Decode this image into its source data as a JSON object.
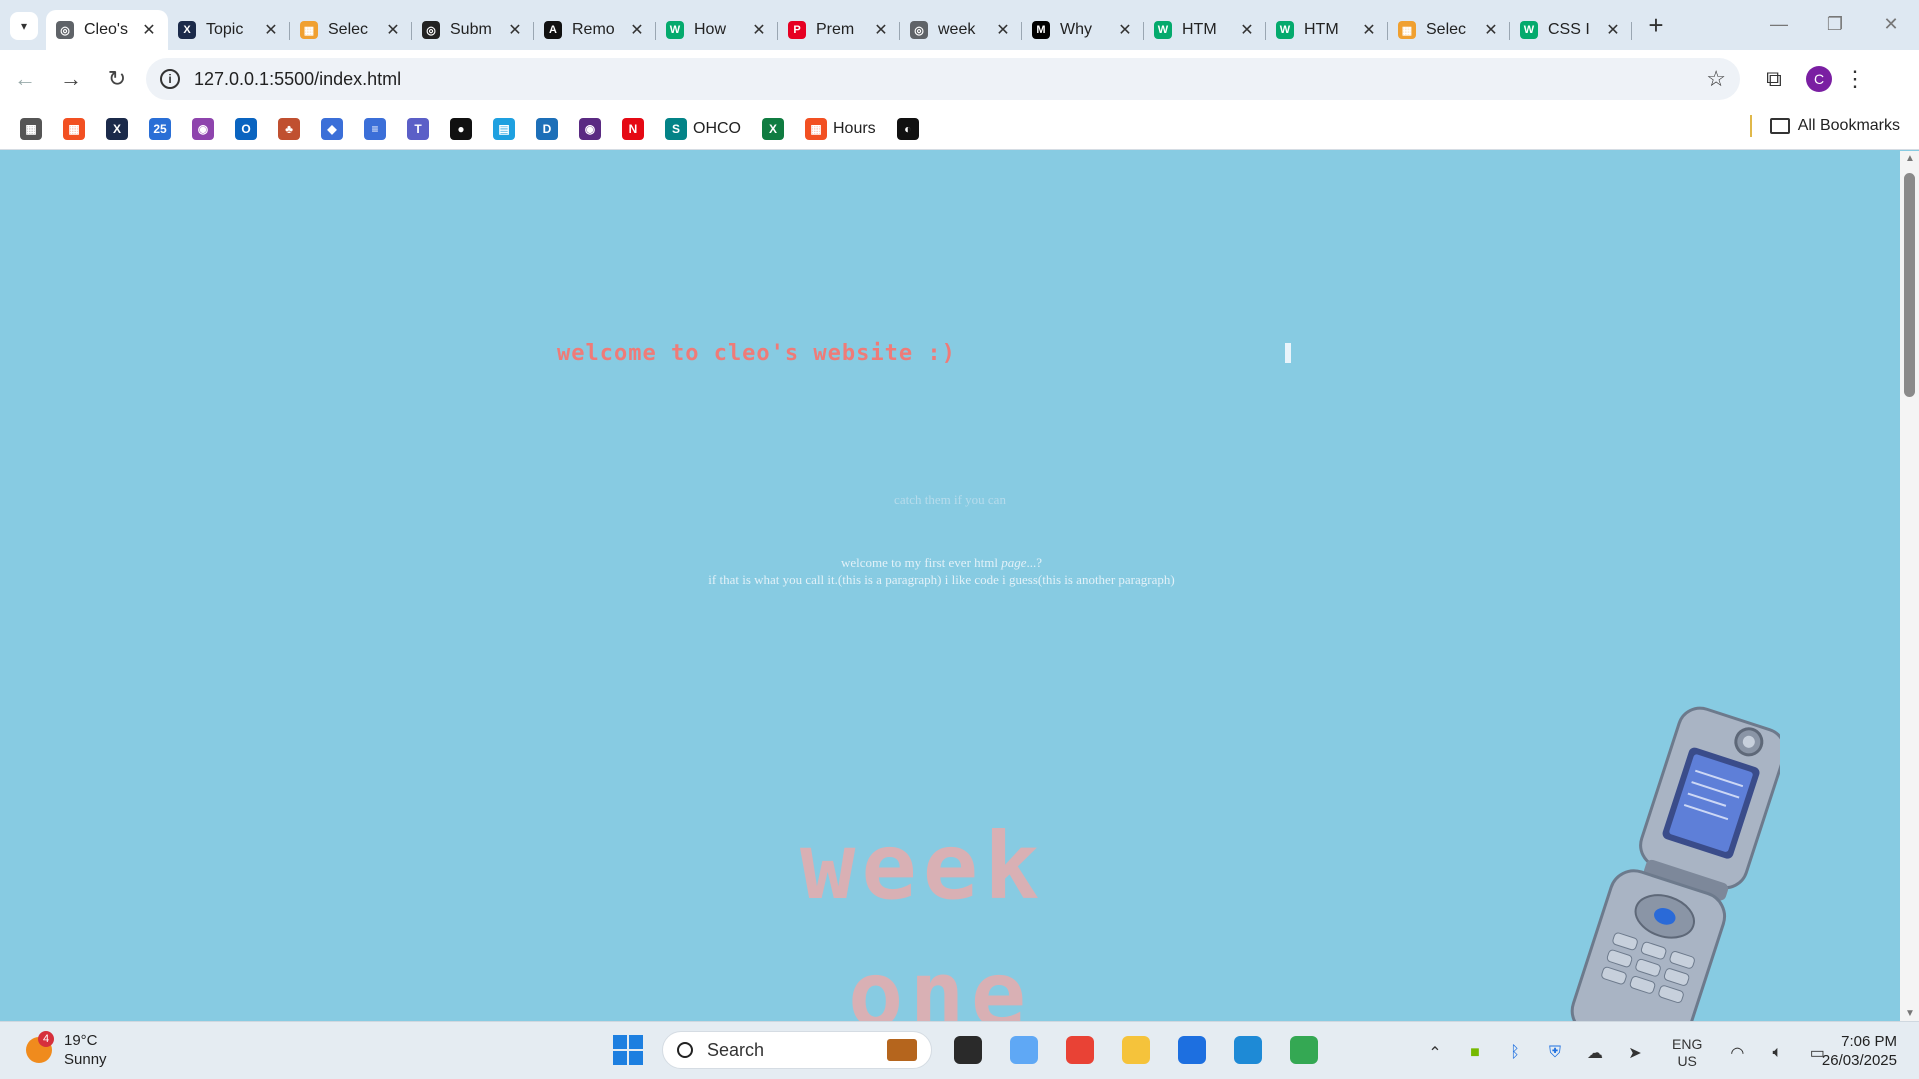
{
  "browser": {
    "tabs": [
      {
        "label": "Cleo's",
        "color": "#5f6368",
        "glyph": "◎",
        "active": true
      },
      {
        "label": "Topic",
        "color": "#1b2a4a",
        "glyph": "X"
      },
      {
        "label": "Selec",
        "color": "#f0a030",
        "glyph": "▦"
      },
      {
        "label": "Subm",
        "color": "#222222",
        "glyph": "◎"
      },
      {
        "label": "Remo",
        "color": "#111111",
        "glyph": "A"
      },
      {
        "label": "How",
        "color": "#04aa6d",
        "glyph": "W"
      },
      {
        "label": "Prem",
        "color": "#e60023",
        "glyph": "P"
      },
      {
        "label": "week",
        "color": "#5f6368",
        "glyph": "◎"
      },
      {
        "label": "Why",
        "color": "#000000",
        "glyph": "M"
      },
      {
        "label": "HTM",
        "color": "#04aa6d",
        "glyph": "W"
      },
      {
        "label": "HTM",
        "color": "#04aa6d",
        "glyph": "W"
      },
      {
        "label": "Selec",
        "color": "#f0a030",
        "glyph": "▦"
      },
      {
        "label": "CSS I",
        "color": "#04aa6d",
        "glyph": "W"
      }
    ],
    "tab_close": "✕",
    "new_tab": "+",
    "window": {
      "minimize": "—",
      "restore": "❐",
      "close": "✕"
    },
    "nav": {
      "back": "←",
      "forward": "→",
      "reload": "↻"
    },
    "url": "127.0.0.1:5500/index.html",
    "info_icon": "i",
    "star": "☆",
    "extensions": "⧉",
    "profile_initial": "C",
    "menu": "⋮"
  },
  "bookmarks": {
    "items": [
      {
        "label": "",
        "color": "#555555",
        "glyph": "▦",
        "icon": "apps-icon"
      },
      {
        "label": "",
        "color": "#f25022",
        "glyph": "▦",
        "icon": "microsoft-icon"
      },
      {
        "label": "",
        "color": "#1b2a4a",
        "glyph": "X",
        "icon": "x-icon"
      },
      {
        "label": "",
        "color": "#2a6fd6",
        "glyph": "25",
        "icon": "calendar-icon"
      },
      {
        "label": "",
        "color": "#8e44ad",
        "glyph": "◉",
        "icon": "app-icon"
      },
      {
        "label": "",
        "color": "#0a64c0",
        "glyph": "O",
        "icon": "outlook-icon"
      },
      {
        "label": "",
        "color": "#c05030",
        "glyph": "♣",
        "icon": "app-icon"
      },
      {
        "label": "",
        "color": "#3b6fd8",
        "glyph": "◆",
        "icon": "app-icon"
      },
      {
        "label": "",
        "color": "#3b6fd8",
        "glyph": "≡",
        "icon": "docs-icon"
      },
      {
        "label": "",
        "color": "#5b5fc7",
        "glyph": "T",
        "icon": "teams-icon"
      },
      {
        "label": "",
        "color": "#111111",
        "glyph": "●",
        "icon": "app-icon"
      },
      {
        "label": "",
        "color": "#1ea0e0",
        "glyph": "▤",
        "icon": "app-icon"
      },
      {
        "label": "",
        "color": "#1d6fb8",
        "glyph": "D",
        "icon": "app-icon"
      },
      {
        "label": "",
        "color": "#5a2a82",
        "glyph": "◉",
        "icon": "app-icon"
      },
      {
        "label": "",
        "color": "#e50914",
        "glyph": "N",
        "icon": "netflix-icon"
      },
      {
        "label": "OHCO",
        "color": "#038387",
        "glyph": "S",
        "icon": "sharepoint-icon"
      },
      {
        "label": "",
        "color": "#107c41",
        "glyph": "X",
        "icon": "excel-icon"
      },
      {
        "label": "Hours",
        "color": "#f25022",
        "glyph": "▦",
        "icon": "microsoft-icon"
      },
      {
        "label": "",
        "color": "#111111",
        "glyph": "◐",
        "icon": "github-icon"
      }
    ],
    "all_bookmarks": "All Bookmarks"
  },
  "page": {
    "heading": "welcome to cleo's website :)",
    "catch": "catch them if you can",
    "para1_start": "welcome to my first ever html ",
    "para1_em": "page",
    "para1_end": "...?",
    "para2": "if that is what you call it.(this is a paragraph) i like code i guess(this is another paragraph)",
    "big_word_1": "week",
    "big_word_2": "one",
    "background": "#87cbe2",
    "heading_color": "#ef7b78"
  },
  "taskbar": {
    "weather_temp": "19°C",
    "weather_desc": "Sunny",
    "weather_badge": "4",
    "search_label": "Search",
    "lang_line1": "ENG",
    "lang_line2": "US",
    "time": "7:06 PM",
    "date": "26/03/2025",
    "apps": [
      {
        "icon": "task-view-icon",
        "color": "#2a2a2a"
      },
      {
        "icon": "copilot-icon",
        "color": "#5fa8f5"
      },
      {
        "icon": "chrome-icon",
        "color": "#e94235"
      },
      {
        "icon": "file-explorer-icon",
        "color": "#f5c33b"
      },
      {
        "icon": "store-icon",
        "color": "#1d6fe0"
      },
      {
        "icon": "vscode-icon",
        "color": "#1e8ad6"
      },
      {
        "icon": "chrome-profile-icon",
        "color": "#34a853"
      }
    ]
  }
}
